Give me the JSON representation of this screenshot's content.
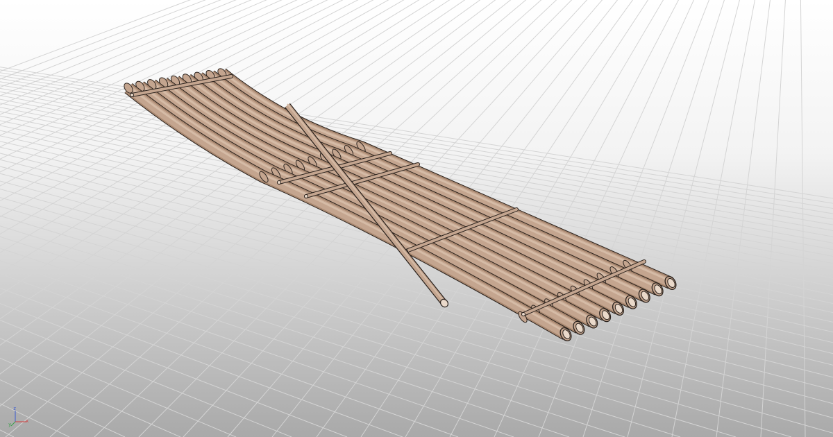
{
  "viewport": {
    "background_top": "#ffffff",
    "background_bottom": "#a9a9a9",
    "grid_color": "#d4d4d4"
  },
  "model": {
    "icon": "bamboo-raft-model",
    "log_count": 9,
    "crossbar_count": 5,
    "brace_count": 1,
    "colors": {
      "log_fill": "#c4a58f",
      "log_highlight": "#d5bba6",
      "log_shadow": "#a8876f",
      "outline": "#2a221d",
      "end_hole": "#ead9ca"
    }
  },
  "axis_gizmo": {
    "icon": "axis-triad-icon",
    "x_label": "x",
    "y_label": "y",
    "z_label": "z",
    "x_color": "#d03a3a",
    "y_color": "#3aa04a",
    "z_color": "#3a5ad0"
  }
}
